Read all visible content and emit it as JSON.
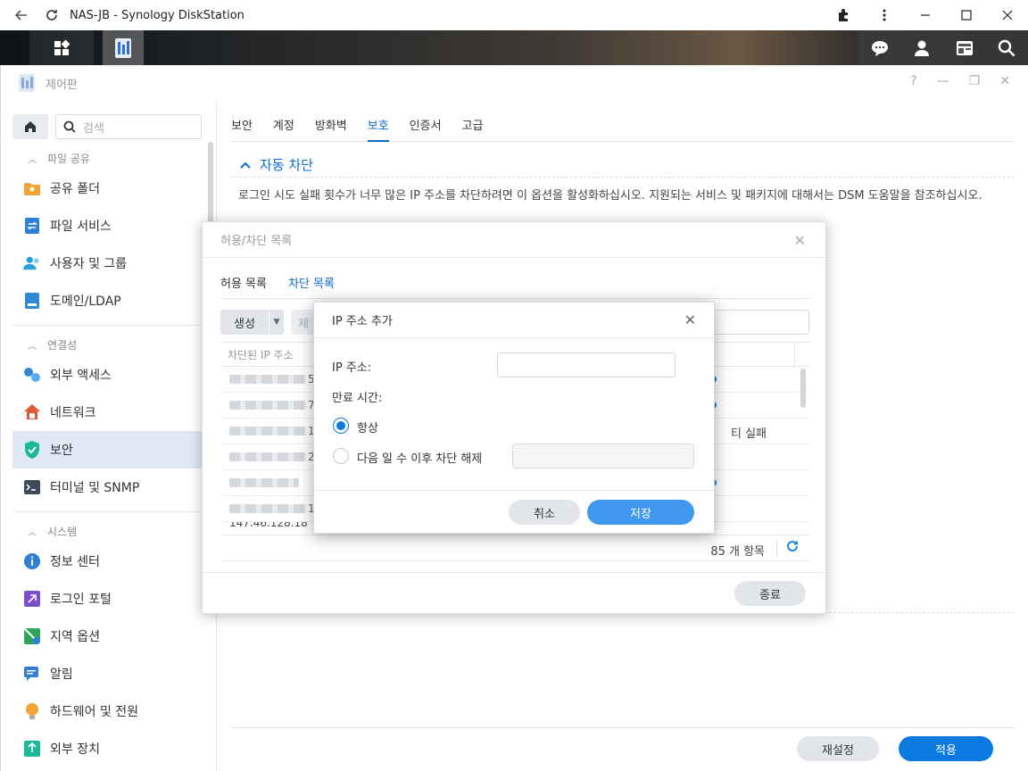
{
  "browser": {
    "title": "NAS-JB - Synology DiskStation"
  },
  "window": {
    "title": "제어판"
  },
  "sidebar": {
    "search_placeholder": "검색",
    "sections": [
      {
        "label": "파일 공유",
        "items": [
          {
            "label": "공유 폴더",
            "icon": "shared-folder-icon",
            "color": "#f0a630"
          },
          {
            "label": "파일 서비스",
            "icon": "file-services-icon",
            "color": "#2f7fd4"
          },
          {
            "label": "사용자 및 그룹",
            "icon": "users-icon",
            "color": "#2aa0d8"
          },
          {
            "label": "도메인/LDAP",
            "icon": "domain-icon",
            "color": "#2f88d6"
          }
        ]
      },
      {
        "label": "연결성",
        "items": [
          {
            "label": "외부 액세스",
            "icon": "external-access-icon",
            "color": "#2f88d6"
          },
          {
            "label": "네트워크",
            "icon": "network-icon",
            "color": "#e05a3a"
          },
          {
            "label": "보안",
            "icon": "security-shield-icon",
            "color": "#1bb99a",
            "active": true
          },
          {
            "label": "터미널 및 SNMP",
            "icon": "terminal-icon",
            "color": "#3c4a5a"
          }
        ]
      },
      {
        "label": "시스템",
        "items": [
          {
            "label": "정보 센터",
            "icon": "info-icon",
            "color": "#2f7fd4"
          },
          {
            "label": "로그인 포털",
            "icon": "login-portal-icon",
            "color": "#7b4fc8"
          },
          {
            "label": "지역 옵션",
            "icon": "regional-options-icon",
            "color": "#2fa55a"
          },
          {
            "label": "알림",
            "icon": "notification-icon",
            "color": "#2f7fd4"
          },
          {
            "label": "하드웨어 및 전원",
            "icon": "hardware-power-icon",
            "color": "#f2a534"
          },
          {
            "label": "외부 장치",
            "icon": "external-devices-icon",
            "color": "#1bb99a"
          }
        ]
      }
    ]
  },
  "main": {
    "tabs": [
      "보안",
      "계정",
      "방화벽",
      "보호",
      "인증서",
      "고급"
    ],
    "active_tab": "보호",
    "section_title": "자동 차단",
    "description": "로그인 시도 실패 횟수가 너무 많은 IP 주소를 차단하려면 이 옵션을 활성화하십시오. 지원되는 서비스 및 패키지에 대해서는 DSM 도움말을 참조하십시오.",
    "reset_label": "재설정",
    "apply_label": "적용"
  },
  "list_dialog": {
    "title": "허용/차단 목록",
    "tabs": [
      "허용 목록",
      "차단 목록"
    ],
    "active_tab": "차단 목록",
    "create_label": "생성",
    "delete_label": "제",
    "column_ip": "차단된 IP 주소",
    "rows": [
      {
        "suffix": "5"
      },
      {
        "suffix": "7"
      },
      {
        "suffix": "1",
        "reason": "티 실패"
      },
      {
        "suffix": "2"
      },
      {
        "suffix": ""
      },
      {
        "suffix": "1"
      }
    ],
    "partial_row": "147.46.128.18",
    "count_label": "85 개 항목",
    "close_label": "종료"
  },
  "add_ip_dialog": {
    "title": "IP 주소 추가",
    "ip_label": "IP 주소:",
    "ip_value": "",
    "expiry_label": "만료 시간:",
    "option_always": "항상",
    "option_days": "다음 일 수 이후 차단 해제",
    "selected_option": "항상",
    "cancel_label": "취소",
    "save_label": "저장"
  },
  "colors": {
    "accent": "#0b7ae0",
    "active_bg": "#dfe9f6"
  }
}
